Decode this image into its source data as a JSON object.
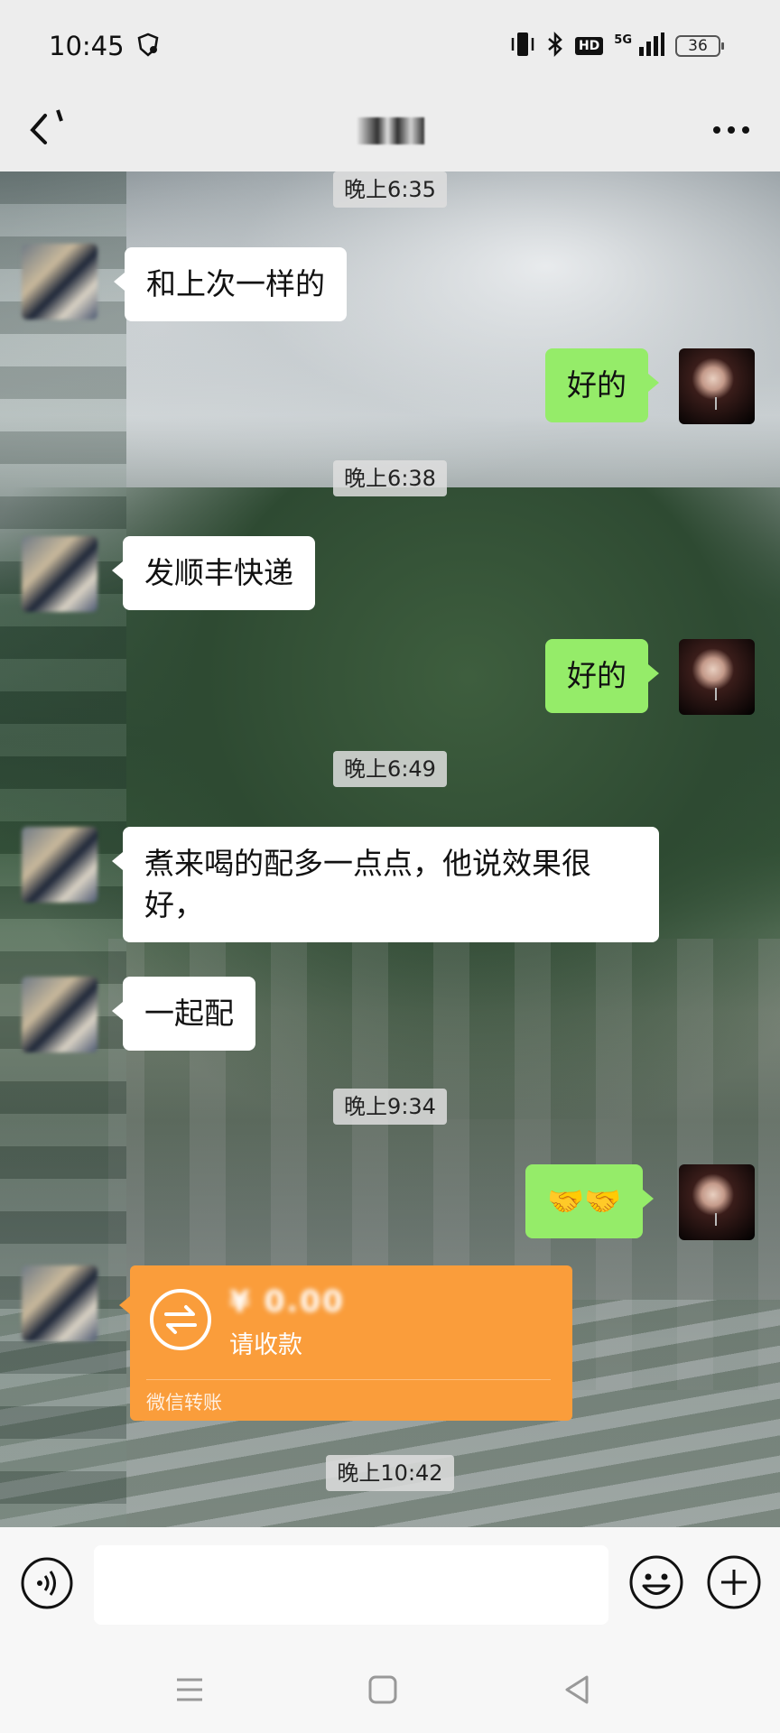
{
  "status_bar": {
    "time": "10:45",
    "network": "5G",
    "hd": "HD",
    "battery": "36"
  },
  "header": {
    "contact_name": ""
  },
  "messages": [
    {
      "type": "time",
      "text": "晚上6:35"
    },
    {
      "type": "text",
      "side": "left",
      "text": "和上次一样的"
    },
    {
      "type": "text",
      "side": "right",
      "text": "好的"
    },
    {
      "type": "time",
      "text": "晚上6:38"
    },
    {
      "type": "text",
      "side": "left",
      "text": "发顺丰快递"
    },
    {
      "type": "text",
      "side": "right",
      "text": "好的"
    },
    {
      "type": "time",
      "text": "晚上6:49"
    },
    {
      "type": "text",
      "side": "left",
      "text": "煮来喝的配多一点点，他说效果很好，"
    },
    {
      "type": "text",
      "side": "left",
      "text": "一起配"
    },
    {
      "type": "time",
      "text": "晚上9:34"
    },
    {
      "type": "text",
      "side": "right",
      "text": "🤝🤝"
    },
    {
      "type": "transfer",
      "side": "left",
      "amount": "¥ 0.00",
      "title": "请收款",
      "footer": "微信转账"
    },
    {
      "type": "time",
      "text": "晚上10:42"
    }
  ],
  "input": {
    "placeholder": ""
  },
  "colors": {
    "self_bubble": "#95ec69",
    "other_bubble": "#ffffff",
    "transfer": "#fa9d3b"
  }
}
